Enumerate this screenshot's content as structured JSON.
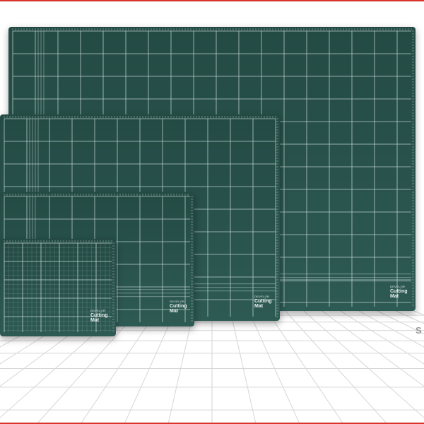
{
  "colors": {
    "accent_rule": "#d9342b",
    "mat_fill": "#244a44",
    "mat_fill_light": "#2e5a54",
    "grid_line": "#cfe0dc",
    "floor_line": "#d6d6d6"
  },
  "mats": [
    {
      "id": "mat-xl",
      "brand": "DEVELOR",
      "title_line1": "Cutting",
      "title_line2": "Mat",
      "sub": ""
    },
    {
      "id": "mat-l",
      "brand": "DEVELOR",
      "title_line1": "Cutting",
      "title_line2": "Mat",
      "sub": ""
    },
    {
      "id": "mat-m",
      "brand": "DEVELOR",
      "title_line1": "Cutting",
      "title_line2": "Mat",
      "sub": ""
    },
    {
      "id": "mat-s",
      "brand": "DEVELOR",
      "title_line1": "Cutting",
      "title_line2": "Mat",
      "sub": ""
    }
  ],
  "side_text": "S"
}
